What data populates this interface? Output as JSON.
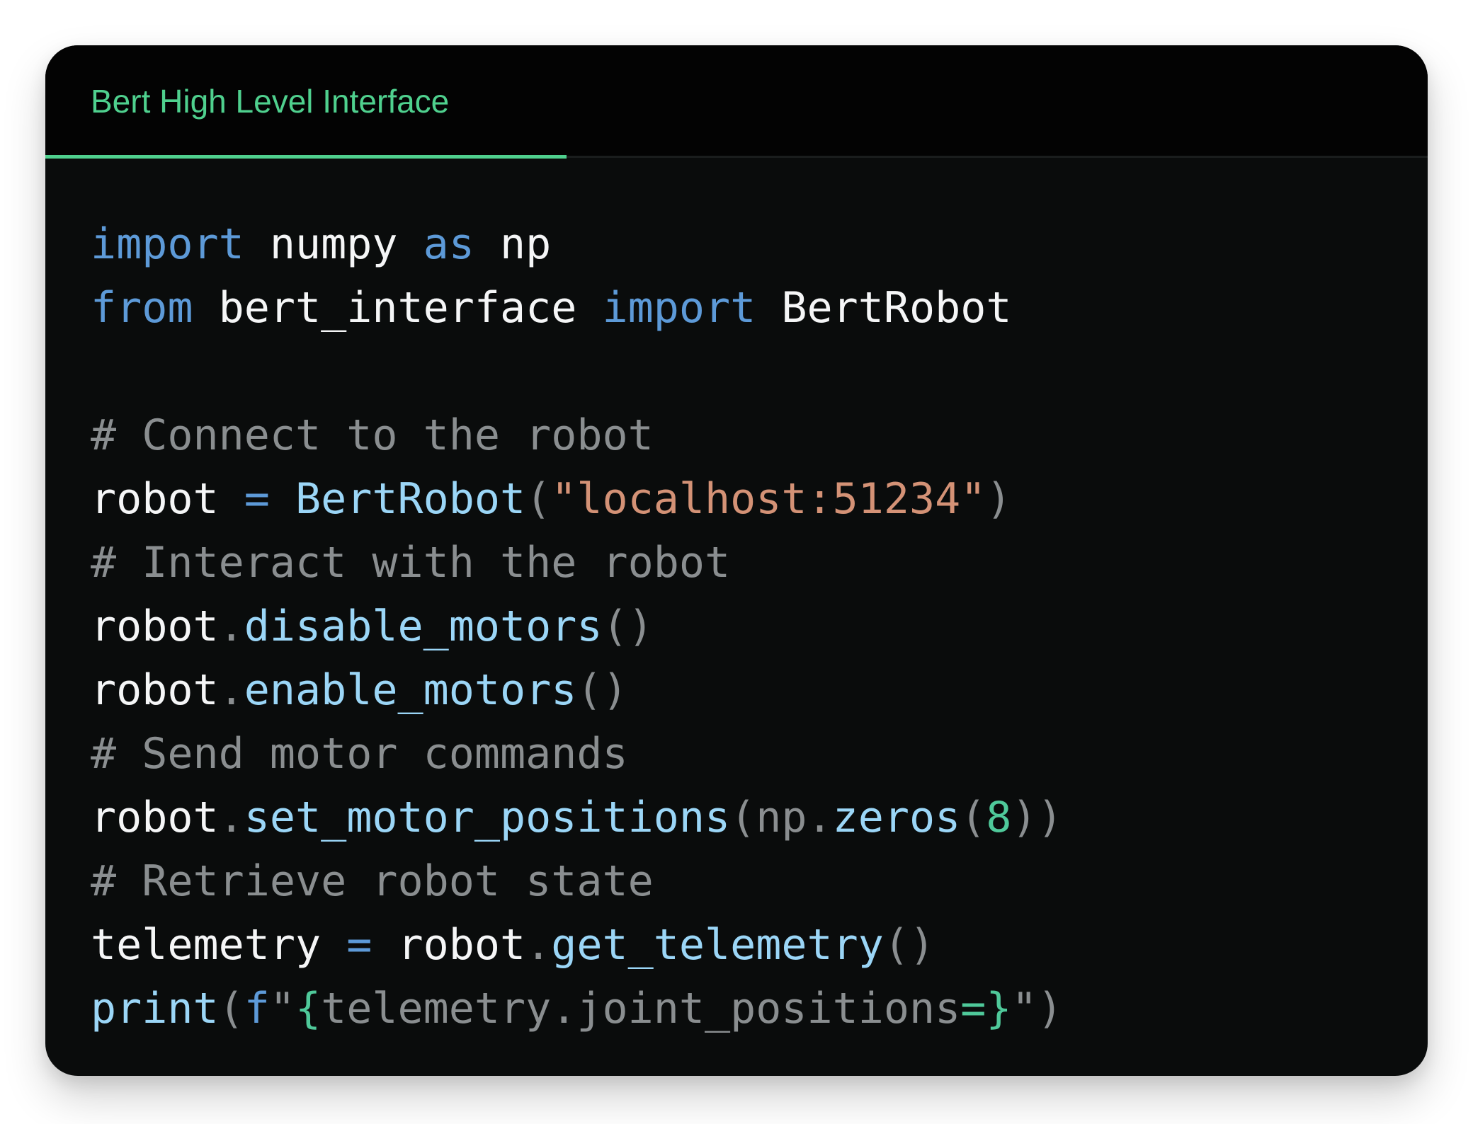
{
  "tab": {
    "label": "Bert High Level Interface"
  },
  "colors": {
    "accent": "#4fd08e",
    "keyword": "#5d9ad8",
    "function": "#9bd6f7",
    "string": "#d49276",
    "number": "#4fc99a",
    "comment": "#8a8e90",
    "text": "#f5f6f7",
    "background": "#0a0c0c"
  },
  "code": {
    "language": "python",
    "lines": [
      [
        {
          "t": "import",
          "k": "kw"
        },
        {
          "t": " numpy ",
          "k": "plain"
        },
        {
          "t": "as",
          "k": "kw"
        },
        {
          "t": " np",
          "k": "plain"
        }
      ],
      [
        {
          "t": "from",
          "k": "kw"
        },
        {
          "t": " bert_interface ",
          "k": "plain"
        },
        {
          "t": "import",
          "k": "kw"
        },
        {
          "t": " BertRobot",
          "k": "plain"
        }
      ],
      [],
      [
        {
          "t": "# Connect to the robot",
          "k": "comment"
        }
      ],
      [
        {
          "t": "robot ",
          "k": "plain"
        },
        {
          "t": "=",
          "k": "op"
        },
        {
          "t": " ",
          "k": "plain"
        },
        {
          "t": "BertRobot",
          "k": "cls"
        },
        {
          "t": "(",
          "k": "punct"
        },
        {
          "t": "\"localhost:51234\"",
          "k": "str"
        },
        {
          "t": ")",
          "k": "punct"
        }
      ],
      [
        {
          "t": "# Interact with the robot",
          "k": "comment"
        }
      ],
      [
        {
          "t": "robot",
          "k": "plain"
        },
        {
          "t": ".",
          "k": "punct"
        },
        {
          "t": "disable_motors",
          "k": "fn"
        },
        {
          "t": "()",
          "k": "punct"
        }
      ],
      [
        {
          "t": "robot",
          "k": "plain"
        },
        {
          "t": ".",
          "k": "punct"
        },
        {
          "t": "enable_motors",
          "k": "fn"
        },
        {
          "t": "()",
          "k": "punct"
        }
      ],
      [
        {
          "t": "# Send motor commands",
          "k": "comment"
        }
      ],
      [
        {
          "t": "robot",
          "k": "plain"
        },
        {
          "t": ".",
          "k": "punct"
        },
        {
          "t": "set_motor_positions",
          "k": "fn"
        },
        {
          "t": "(",
          "k": "punct"
        },
        {
          "t": "np",
          "k": "dim"
        },
        {
          "t": ".",
          "k": "punct"
        },
        {
          "t": "zeros",
          "k": "fn"
        },
        {
          "t": "(",
          "k": "punct"
        },
        {
          "t": "8",
          "k": "num"
        },
        {
          "t": "))",
          "k": "punct"
        }
      ],
      [
        {
          "t": "# Retrieve robot state",
          "k": "comment"
        }
      ],
      [
        {
          "t": "telemetry ",
          "k": "plain"
        },
        {
          "t": "=",
          "k": "op"
        },
        {
          "t": " robot",
          "k": "plain"
        },
        {
          "t": ".",
          "k": "punct"
        },
        {
          "t": "get_telemetry",
          "k": "fn"
        },
        {
          "t": "()",
          "k": "punct"
        }
      ],
      [
        {
          "t": "print",
          "k": "bi"
        },
        {
          "t": "(",
          "k": "punct"
        },
        {
          "t": "f",
          "k": "kw"
        },
        {
          "t": "\"",
          "k": "punct"
        },
        {
          "t": "{",
          "k": "brace"
        },
        {
          "t": "telemetry.joint_positions",
          "k": "dim"
        },
        {
          "t": "=",
          "k": "brace"
        },
        {
          "t": "}",
          "k": "brace"
        },
        {
          "t": "\")",
          "k": "punct"
        }
      ]
    ]
  }
}
